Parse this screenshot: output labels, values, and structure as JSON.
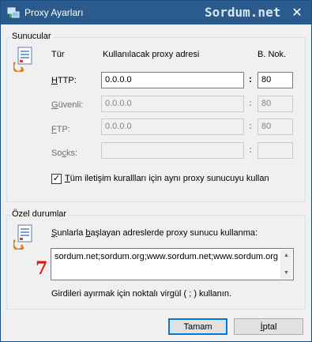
{
  "window": {
    "title": "Proxy Ayarları",
    "watermark": "Sordum.net",
    "close_glyph": "✕"
  },
  "servers_group": {
    "label": "Sunucular",
    "col_type": "Tür",
    "col_address": "Kullanılacak proxy adresi",
    "col_port": "B. Nok.",
    "rows": [
      {
        "type_pre": "",
        "type_u": "H",
        "type_post": "TTP:",
        "address": "0.0.0.0",
        "port": "80",
        "enabled": true
      },
      {
        "type_pre": "",
        "type_u": "G",
        "type_post": "üvenli:",
        "address": "0.0.0.0",
        "port": "80",
        "enabled": false
      },
      {
        "type_pre": "",
        "type_u": "F",
        "type_post": "TP:",
        "address": "0.0.0.0",
        "port": "80",
        "enabled": false
      },
      {
        "type_pre": "So",
        "type_u": "c",
        "type_post": "ks:",
        "address": "",
        "port": "",
        "enabled": false
      }
    ],
    "colon": ":",
    "same_proxy_checked": true,
    "same_proxy_pre": "",
    "same_proxy_u": "T",
    "same_proxy_post": "üm iletişim kurallları için aynı proxy sunucuyu kullan"
  },
  "exceptions_group": {
    "label": "Özel durumlar",
    "desc_pre": "",
    "desc_u": "Ş",
    "desc_mid": "unlarla ",
    "desc_u2": "b",
    "desc_post": "aşlayan adreslerde proxy sunucu kullanma:",
    "value": "sordum.net;sordum.org;www.sordum.net;www.sordum.org",
    "hint": "Girdileri ayırmak için noktalı virgül ( ; ) kullanın.",
    "annotation": "7"
  },
  "buttons": {
    "ok": "Tamam",
    "cancel_pre": "",
    "cancel_u": "İ",
    "cancel_post": "ptal"
  },
  "colors": {
    "titlebar": "#2b5a8c",
    "annotation": "#e0140f",
    "default_button_border": "#0078d7"
  }
}
